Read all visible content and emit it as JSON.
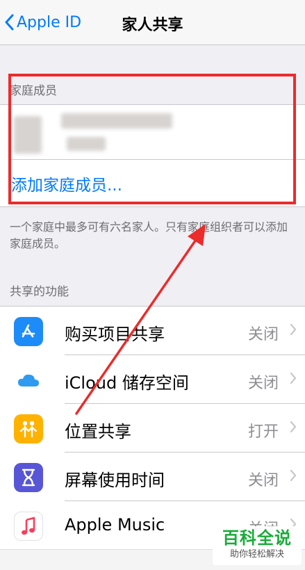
{
  "nav": {
    "back_label": "Apple ID",
    "title": "家人共享"
  },
  "family": {
    "header": "家庭成员",
    "add_label": "添加家庭成员...",
    "footnote": "一个家庭中最多可有六名家人。只有家庭组织者可以添加家庭成员。"
  },
  "features": {
    "header": "共享的功能",
    "items": [
      {
        "label": "购买项目共享",
        "value": "关闭",
        "icon": "app-store-icon",
        "color": "#1e8cf8"
      },
      {
        "label": "iCloud 储存空间",
        "value": "关闭",
        "icon": "icloud-icon",
        "color": "#ffffff"
      },
      {
        "label": "位置共享",
        "value": "打开",
        "icon": "find-my-people-icon",
        "color": "#ffb200"
      },
      {
        "label": "屏幕使用时间",
        "value": "关闭",
        "icon": "hourglass-icon",
        "color": "#5856d6"
      },
      {
        "label": "Apple Music",
        "value": "关闭",
        "icon": "music-note-icon",
        "color": "#ffffff"
      }
    ]
  },
  "watermark": {
    "title": "百科全说",
    "subtitle": "助你轻松解决"
  },
  "colors": {
    "accent": "#007aff",
    "highlight": "#ec2b2b",
    "watermark_green": "#1aab3a"
  }
}
